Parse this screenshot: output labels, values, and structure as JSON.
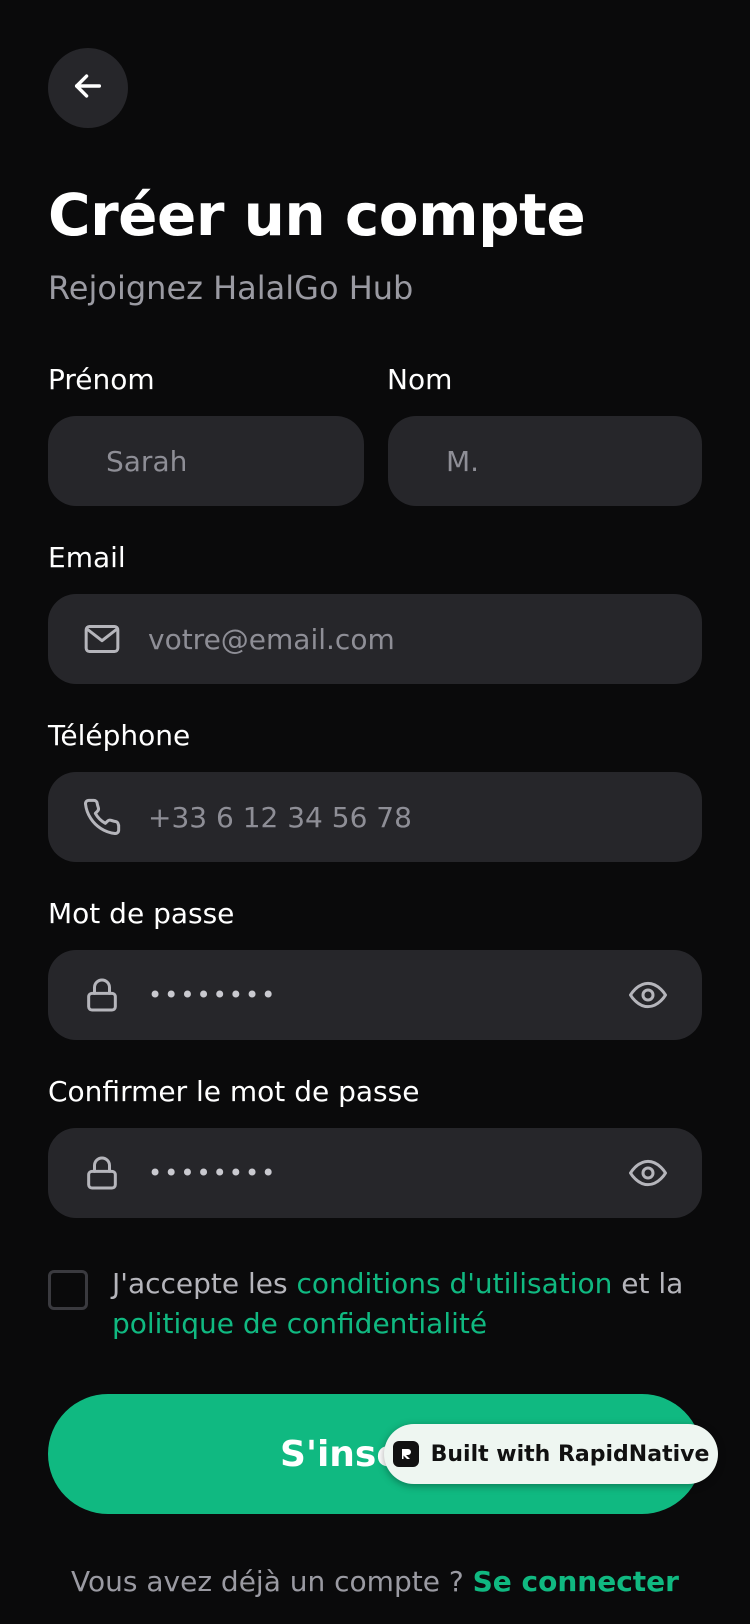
{
  "header": {
    "title": "Créer un compte",
    "subtitle": "Rejoignez HalalGo Hub"
  },
  "form": {
    "first_name": {
      "label": "Prénom",
      "placeholder": "Sarah"
    },
    "last_name": {
      "label": "Nom",
      "placeholder": "M."
    },
    "email": {
      "label": "Email",
      "placeholder": "votre@email.com",
      "icon": "mail-icon"
    },
    "phone": {
      "label": "Téléphone",
      "placeholder": "+33 6 12 34 56 78",
      "icon": "phone-icon"
    },
    "password": {
      "label": "Mot de passe",
      "value": "••••••••",
      "icon": "lock-icon",
      "toggle_icon": "eye-icon"
    },
    "confirm_password": {
      "label": "Confirmer le mot de passe",
      "value": "••••••••",
      "icon": "lock-icon",
      "toggle_icon": "eye-icon"
    }
  },
  "terms": {
    "prefix": "J'accepte les ",
    "terms_link": "conditions d'utilisation",
    "middle": " et la",
    "privacy_link": "politique de confidentialité",
    "checked": false
  },
  "submit_label": "S'inscrire",
  "badge": {
    "label": "Built with RapidNative"
  },
  "footer": {
    "text": "Vous avez déjà un compte ? ",
    "login_link": "Se connecter"
  },
  "colors": {
    "accent": "#10b981",
    "background": "#0a0a0b",
    "field": "#26262a"
  }
}
